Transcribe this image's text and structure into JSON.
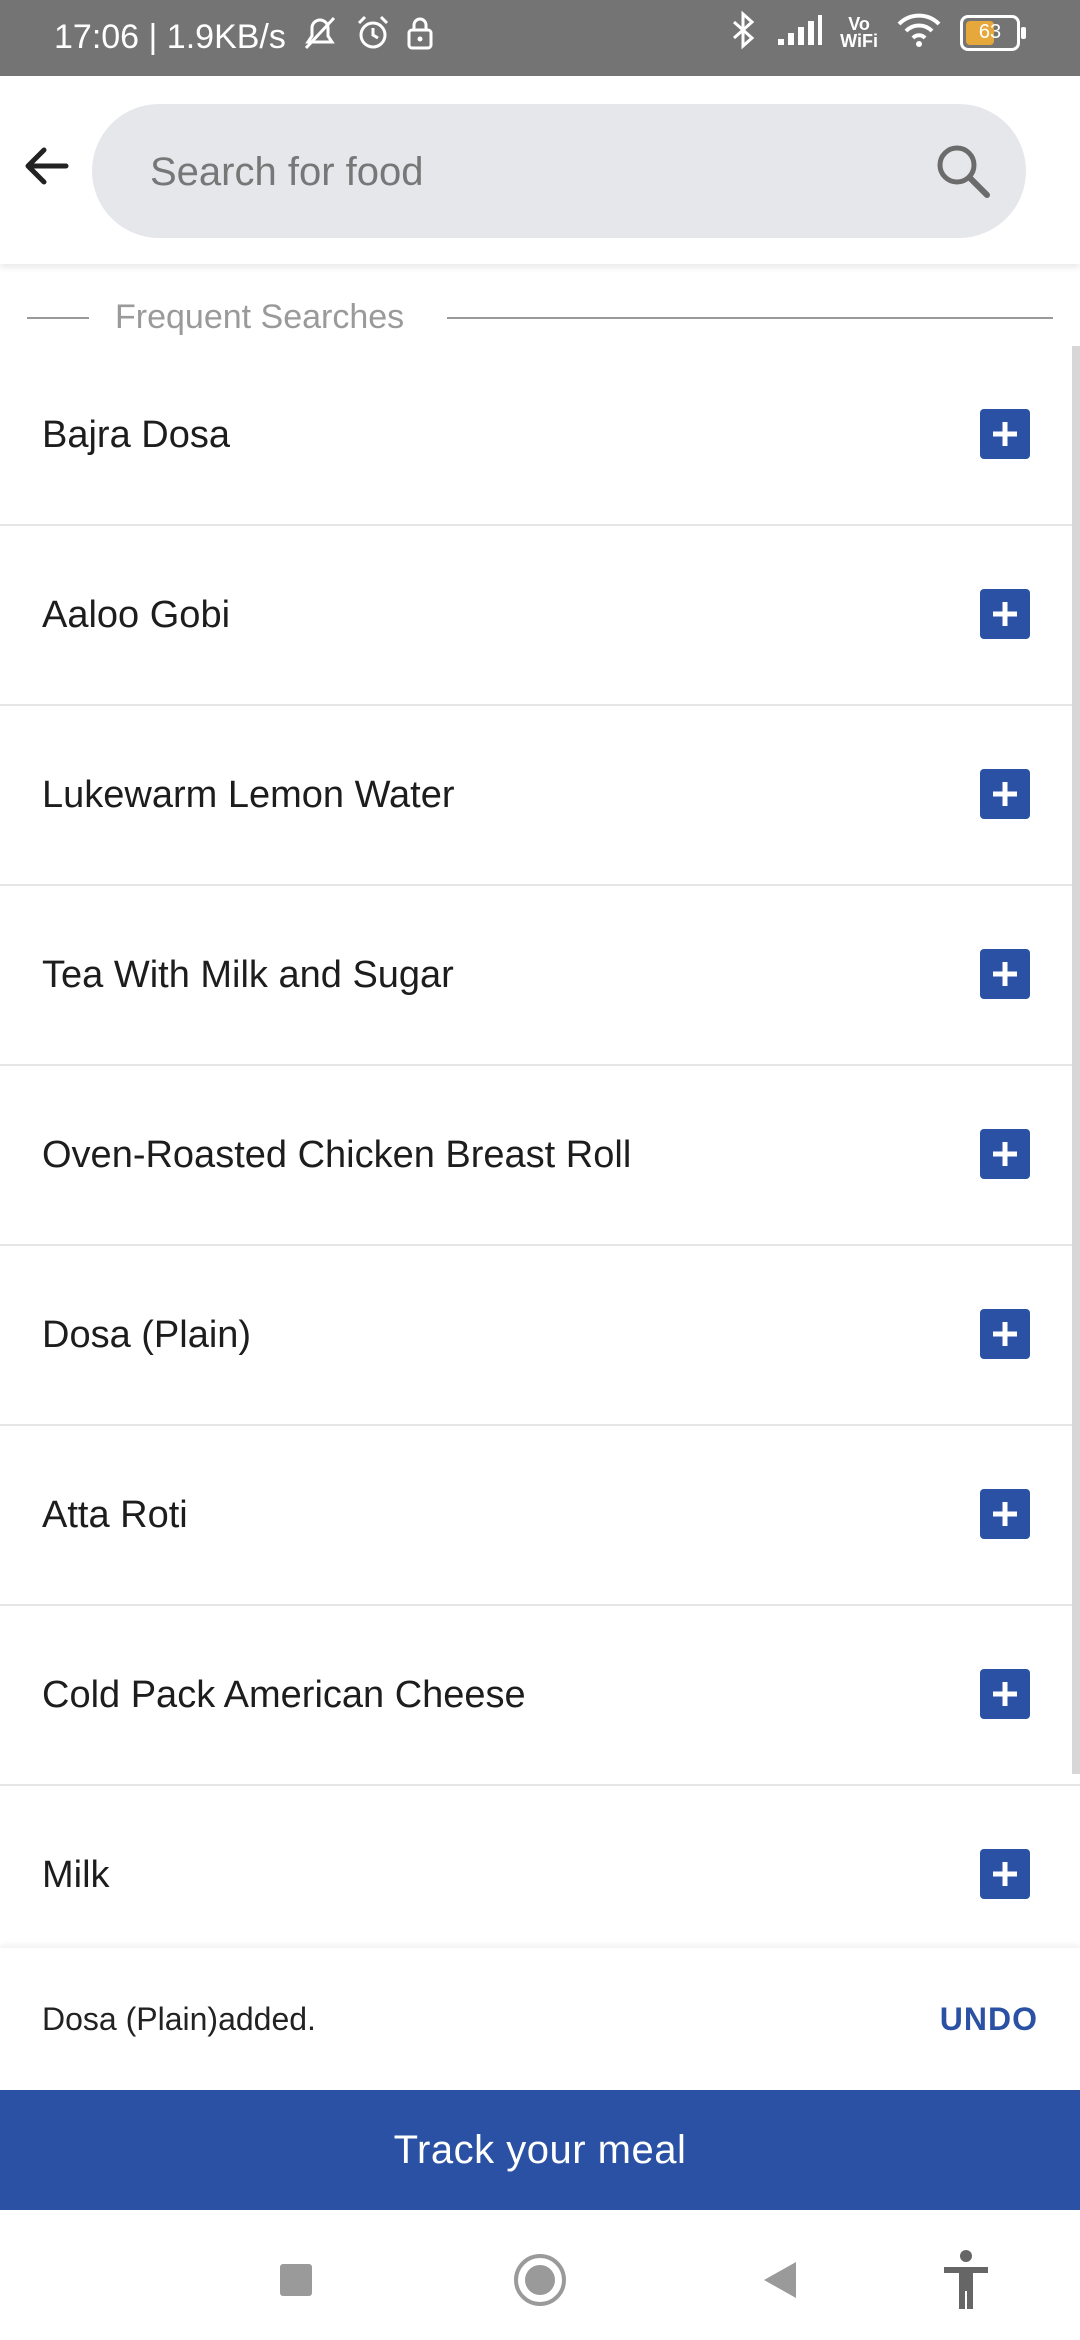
{
  "status_bar": {
    "time_speed": "17:06 | 1.9KB/s",
    "vowifi_top": "Vo",
    "vowifi_bottom": "WiFi",
    "battery": "63",
    "battery_level": 0.63,
    "icons": [
      "mute-icon",
      "alarm-icon",
      "lock-icon",
      "bluetooth-icon",
      "signal-icon",
      "wifi-icon",
      "battery-icon"
    ]
  },
  "header": {
    "search_placeholder": "Search for food"
  },
  "section": {
    "title": "Frequent Searches"
  },
  "items": [
    {
      "label": "Bajra Dosa"
    },
    {
      "label": "Aaloo Gobi"
    },
    {
      "label": "Lukewarm Lemon Water"
    },
    {
      "label": "Tea With Milk and Sugar"
    },
    {
      "label": "Oven-Roasted Chicken Breast Roll"
    },
    {
      "label": "Dosa (Plain)"
    },
    {
      "label": "Atta Roti"
    },
    {
      "label": "Cold Pack American Cheese"
    },
    {
      "label": "Milk"
    }
  ],
  "snackbar": {
    "message": "Dosa (Plain)added.",
    "action": "UNDO"
  },
  "track_button": "Track your meal",
  "colors": {
    "accent": "#2a51a3",
    "status_bar": "#747474",
    "search_bg": "#e6e7eb"
  }
}
